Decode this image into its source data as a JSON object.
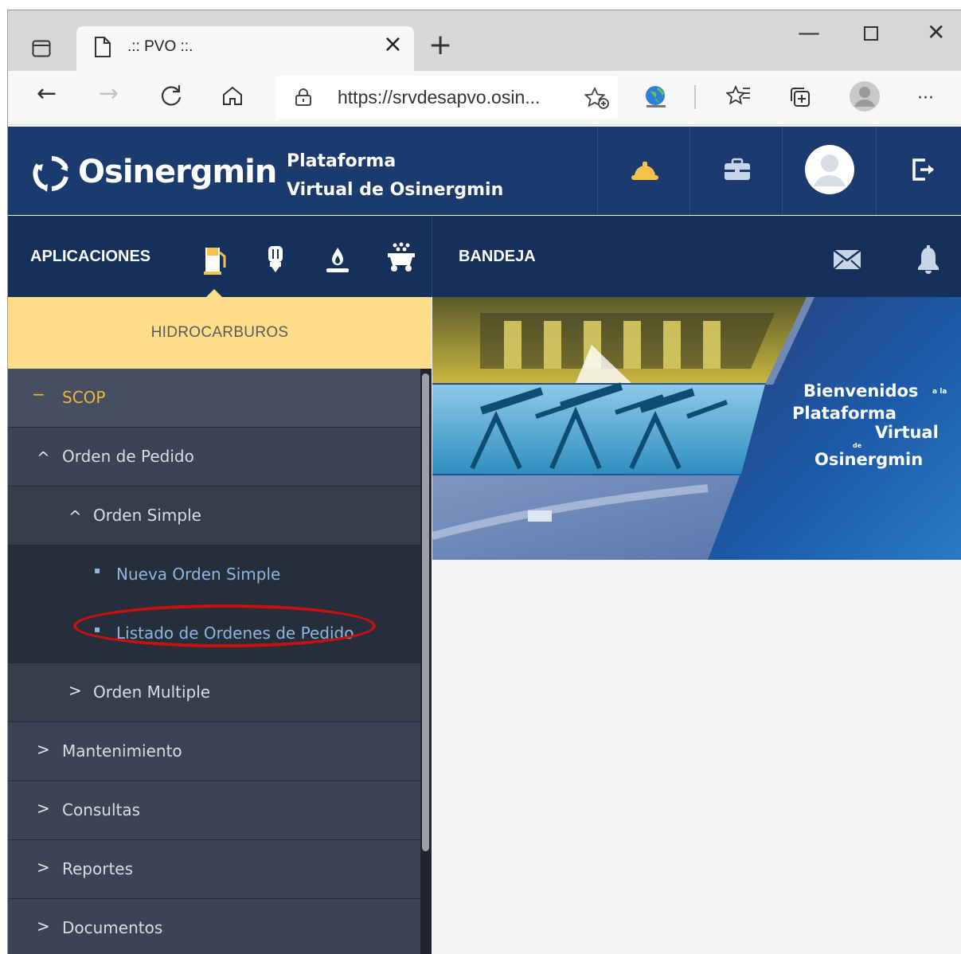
{
  "browser": {
    "tab_title": ".:: PVO ::.",
    "url": "https://srvdesapvo.osin..."
  },
  "header": {
    "logo_text": "Osinergmin",
    "platform_line1": "Plataforma",
    "platform_line2": "Virtual de Osinergmin",
    "icons": [
      "helmet-icon",
      "briefcase-icon",
      "user-avatar",
      "logout-icon"
    ]
  },
  "appbar": {
    "applications_label": "APLICACIONES",
    "app_icons": [
      "fuel-pump-icon",
      "electricity-icon",
      "gas-flame-icon",
      "mining-cart-icon"
    ],
    "tray_label": "BANDEJA",
    "tray_icons": [
      "mail-icon",
      "bell-icon"
    ]
  },
  "sidebar": {
    "section_title": "HIDROCARBUROS",
    "items": [
      {
        "label": "SCOP",
        "marker": "−"
      },
      {
        "label": "Orden de Pedido",
        "marker": "^"
      },
      {
        "label": "Orden Simple",
        "marker": "^"
      },
      {
        "label": "Nueva Orden Simple",
        "marker": "▪"
      },
      {
        "label": "Listado de Ordenes de Pedido",
        "marker": "▪"
      },
      {
        "label": "Orden Multiple",
        "marker": ">"
      },
      {
        "label": "Mantenimiento",
        "marker": ">"
      },
      {
        "label": "Consultas",
        "marker": ">"
      },
      {
        "label": "Reportes",
        "marker": ">"
      },
      {
        "label": "Documentos",
        "marker": ">"
      }
    ]
  },
  "banner": {
    "line1": "Bienvenidos",
    "line1_small": "a la",
    "line2": "Plataforma",
    "line3": "Virtual",
    "line3_small": "de",
    "line4": "Osinergmin"
  }
}
